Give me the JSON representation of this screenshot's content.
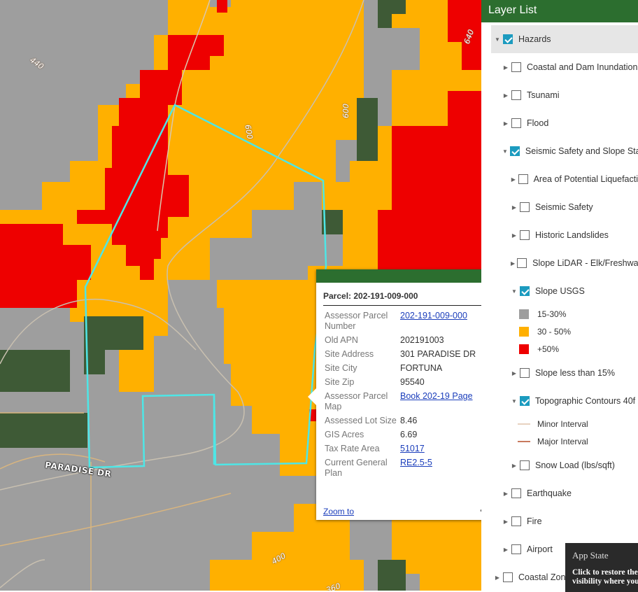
{
  "map": {
    "contour_labels": [
      "440",
      "600",
      "600",
      "640",
      "400",
      "360"
    ],
    "road_label": "PARADISE DR",
    "colors": {
      "gray": "#9e9e9e",
      "orange": "#ffb000",
      "red": "#ee0000",
      "parcel": "#4ee6e6"
    }
  },
  "popup": {
    "title": "Parcel: 202-191-009-000",
    "fields": [
      {
        "key": "Assessor Parcel Number",
        "value": "202-191-009-000",
        "link": true
      },
      {
        "key": "Old APN",
        "value": "202191003",
        "link": false
      },
      {
        "key": "Site Address",
        "value": "301 PARADISE DR",
        "link": false
      },
      {
        "key": "Site City",
        "value": "FORTUNA",
        "link": false
      },
      {
        "key": "Site Zip",
        "value": "95540",
        "link": false
      },
      {
        "key": "Assessor Parcel Map",
        "value": "Book 202-19 Page",
        "link": true
      },
      {
        "key": "Assessed Lot Size",
        "value": "8.46",
        "link": false
      },
      {
        "key": "GIS Acres",
        "value": "6.69",
        "link": false
      },
      {
        "key": "Tax Rate Area",
        "value": "51017",
        "link": true
      },
      {
        "key": "Current General Plan",
        "value": "RE2.5-5",
        "link": true
      }
    ],
    "zoom_label": "Zoom to",
    "more_label": "•••",
    "maximize_icon": "maximize-icon",
    "close_icon": "close-icon"
  },
  "layer_list": {
    "title": "Layer List",
    "items": [
      {
        "label": "Hazards",
        "checked": true,
        "indent": 0,
        "expanded": true,
        "highlight": true
      },
      {
        "label": "Coastal and Dam Inundation",
        "checked": false,
        "indent": 1,
        "expanded": false
      },
      {
        "label": "Tsunami",
        "checked": false,
        "indent": 1,
        "expanded": false
      },
      {
        "label": "Flood",
        "checked": false,
        "indent": 1,
        "expanded": false
      },
      {
        "label": "Seismic Safety and Slope Sta",
        "checked": true,
        "indent": 1,
        "expanded": true
      },
      {
        "label": "Area of Potential Liquefacti",
        "checked": false,
        "indent": 2,
        "expanded": false
      },
      {
        "label": "Seismic Safety",
        "checked": false,
        "indent": 2,
        "expanded": false
      },
      {
        "label": "Historic Landslides",
        "checked": false,
        "indent": 2,
        "expanded": false
      },
      {
        "label": "Slope LiDAR - Elk/Freshwa",
        "checked": false,
        "indent": 2,
        "expanded": false
      },
      {
        "label": "Slope USGS",
        "checked": true,
        "indent": 2,
        "expanded": true
      },
      {
        "label": "Slope less than 15%",
        "checked": false,
        "indent": 2,
        "expanded": false
      },
      {
        "label": "Topographic Contours 40f",
        "checked": true,
        "indent": 2,
        "expanded": true
      },
      {
        "label": "Snow Load (lbs/sqft)",
        "checked": false,
        "indent": 2,
        "expanded": false
      },
      {
        "label": "Earthquake",
        "checked": false,
        "indent": 1,
        "expanded": false
      },
      {
        "label": "Fire",
        "checked": false,
        "indent": 1,
        "expanded": false
      },
      {
        "label": "Airport",
        "checked": false,
        "indent": 1,
        "expanded": false
      },
      {
        "label": "Coastal Zon",
        "checked": false,
        "indent": 0,
        "expanded": false
      }
    ],
    "slope_legend": [
      {
        "label": "15-30%",
        "color": "#9e9e9e"
      },
      {
        "label": "30 - 50%",
        "color": "#ffb000"
      },
      {
        "label": "+50%",
        "color": "#ee0000"
      }
    ],
    "contour_legend": [
      {
        "label": "Minor Interval",
        "color": "#e8d2c0"
      },
      {
        "label": "Major Interval",
        "color": "#c87a5e"
      }
    ]
  },
  "app_state": {
    "title": "App State",
    "description": "Click to restore the visibility where you"
  }
}
